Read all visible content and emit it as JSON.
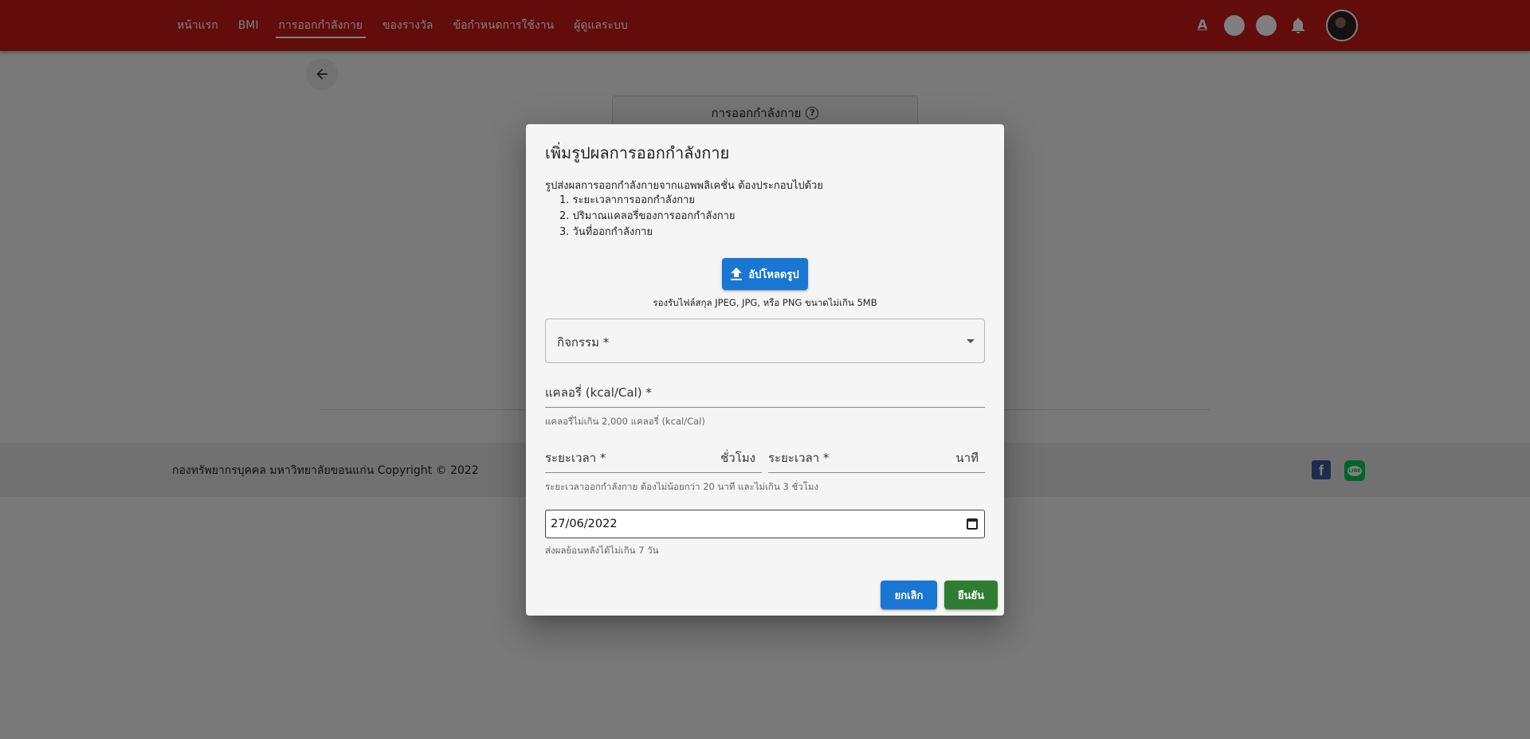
{
  "header": {
    "nav": [
      "หน้าแรก",
      "BMI",
      "การออกกำลังกาย",
      "ของรางวัล",
      "ข้อกำหนดการใช้งาน",
      "ผู้ดูแลระบบ"
    ],
    "active_index": 2,
    "font_size_icon": "A",
    "icons": [
      "text-size-icon",
      "circle-button",
      "circle-button",
      "bell-icon",
      "avatar"
    ]
  },
  "page": {
    "card_title": "การออกกำลังกาย",
    "help_icon": "?",
    "footer_text": "กองทรัพยากรบุคคล มหาวิทยาลัยขอนแก่น Copyright © 2022",
    "social_icons": [
      "facebook-icon",
      "line-icon"
    ],
    "facebook_glyph": "f",
    "line_glyph": "LINE"
  },
  "dialog": {
    "title": "เพิ่มรูปผลการออกกำลังกาย",
    "intro": "รูปส่งผลการออกกำลังกายจากแอพพลิเคชั่น ต้องประกอบไปด้วย",
    "requirements": [
      "1. ระยะเวลาการออกกำลังกาย",
      "2. ปริมาณแคลอรี่ของการออกกำลังกาย",
      "3. วันที่ออกกำลังกาย"
    ],
    "upload_label": "อัปโหลดรูป",
    "upload_hint": "รองรับไฟล์สกุล JPEG, JPG, หรือ PNG ขนาดไม่เกิน 5MB",
    "activity_label": "กิจกรรม *",
    "calories_label": "แคลอรี่ (kcal/Cal) *",
    "calories_helper": "แคลอรี่ไม่เกิน 2,000 แคลอรี่ (kcal/Cal)",
    "duration_hours_label": "ระยะเวลา *",
    "duration_hours_unit": "ชั่วโมง",
    "duration_minutes_label": "ระยะเวลา *",
    "duration_minutes_unit": "นาที",
    "duration_helper": "ระยะเวลาออกกำลังกาย ต้องไม่น้อยกว่า 20 นาที และไม่เกิน 3 ชั่วโมง",
    "date_value": "27/06/2022",
    "date_helper": "ส่งผลย้อนหลังได้ไม่เกิน 7 วัน",
    "cancel_label": "ยกเลิก",
    "confirm_label": "ยืนยัน"
  },
  "colors": {
    "header_bg": "#c41818",
    "primary": "#1976d2",
    "success": "#2e7d32"
  }
}
